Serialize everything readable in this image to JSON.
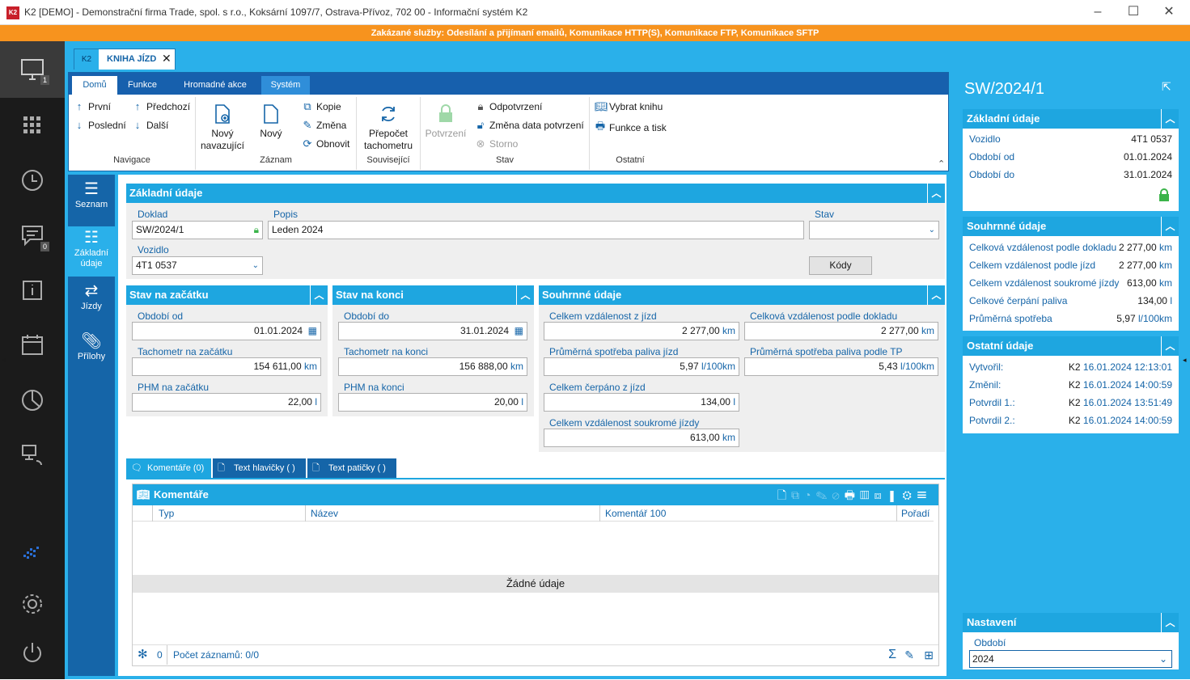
{
  "window": {
    "title": "K2 [DEMO] - Demonstrační firma Trade, spol. s r.o., Koksární 1097/7, Ostrava-Přívoz, 702 00 - Informační systém K2",
    "logo": "K2"
  },
  "warning": "Zakázané služby: Odesílání a přijímaní emailů, Komunikace HTTP(S), Komunikace FTP, Komunikace SFTP",
  "leftnav": {
    "monitor_badge": "1",
    "messages_badge": "0",
    "icons": [
      "monitor-icon",
      "apps-grid-icon",
      "history-icon",
      "messages-icon",
      "info-icon",
      "calendar-icon",
      "pie-chart-icon",
      "remote-support-icon",
      "k2-logo-icon",
      "settings-icon",
      "power-icon"
    ]
  },
  "doc_tab": {
    "prefix": "K2",
    "label": "KNIHA JÍZD",
    "close": "✕"
  },
  "ribbon": {
    "tabs": [
      "Domů",
      "Funkce",
      "Hromadné akce",
      "Systém"
    ],
    "navigation": {
      "first": "První",
      "last": "Poslední",
      "prev": "Předchozí",
      "next": "Další",
      "group": "Navigace"
    },
    "record": {
      "new_follow_1": "Nový",
      "new_follow_2": "navazující",
      "new": "Nový",
      "copy": "Kopie",
      "change": "Změna",
      "refresh": "Obnovit",
      "group": "Záznam"
    },
    "related": {
      "recalc_1": "Přepočet",
      "recalc_2": "tachometru",
      "group": "Související"
    },
    "state": {
      "confirm": "Potvrzení",
      "unconfirm": "Odpotvrzení",
      "change_date": "Změna data potvrzení",
      "storno": "Storno",
      "group": "Stav"
    },
    "other": {
      "select_book": "Vybrat knihu",
      "functions_print": "Funkce a tisk",
      "group": "Ostatní"
    }
  },
  "sidetabs": [
    {
      "label": "Seznam",
      "label2": ""
    },
    {
      "label": "Základní",
      "label2": "údaje"
    },
    {
      "label": "Jízdy",
      "label2": ""
    },
    {
      "label": "Přílohy",
      "label2": ""
    }
  ],
  "basic": {
    "title": "Základní údaje",
    "doklad_label": "Doklad",
    "doklad_value": "SW/2024/1",
    "popis_label": "Popis",
    "popis_value": "Leden 2024",
    "stav_label": "Stav",
    "stav_value": "",
    "vozidlo_label": "Vozidlo",
    "vozidlo_value": "4T1 0537",
    "kody_button": "Kódy"
  },
  "start": {
    "title": "Stav na začátku",
    "period_label": "Období od",
    "period_value": "01.01.2024",
    "tacho_label": "Tachometr na začátku",
    "tacho_value": "154 611,00",
    "tacho_unit": "km",
    "fuel_label": "PHM na začátku",
    "fuel_value": "22,00",
    "fuel_unit": "l"
  },
  "end": {
    "title": "Stav na konci",
    "period_label": "Období do",
    "period_value": "31.01.2024",
    "tacho_label": "Tachometr na konci",
    "tacho_value": "156 888,00",
    "tacho_unit": "km",
    "fuel_label": "PHM na konci",
    "fuel_value": "20,00",
    "fuel_unit": "l"
  },
  "summary": {
    "title": "Souhrnné údaje",
    "total_dist_label": "Celkem vzdálenost z jízd",
    "total_dist_value": "2 277,00",
    "total_dist_unit": "km",
    "doc_dist_label": "Celková vzdálenost podle dokladu",
    "doc_dist_value": "2 277,00",
    "doc_dist_unit": "km",
    "avg_label": "Průměrná spotřeba paliva jízd",
    "avg_value": "5,97",
    "avg_unit": "l/100km",
    "avg_tp_label": "Průměrná spotřeba paliva podle TP",
    "avg_tp_value": "5,43",
    "avg_tp_unit": "l/100km",
    "pumped_label": "Celkem čerpáno z jízd",
    "pumped_value": "134,00",
    "pumped_unit": "l",
    "private_label": "Celkem vzdálenost soukromé jízdy",
    "private_value": "613,00",
    "private_unit": "km"
  },
  "bottom_tabs": [
    "Komentáře (0)",
    "Text hlavičky ( )",
    "Text patičky ( )"
  ],
  "comments": {
    "title": "Komentáře",
    "columns": [
      "Typ",
      "Název",
      "Komentář 100",
      "Pořadí"
    ],
    "empty": "Žádné údaje",
    "count_zero": "0",
    "record_count": "Počet záznamů: 0/0"
  },
  "right": {
    "doc_id": "SW/2024/1",
    "basic": {
      "title": "Základní údaje",
      "rows": [
        {
          "k": "Vozidlo",
          "v": "4T1 0537"
        },
        {
          "k": "Období od",
          "v": "01.01.2024"
        },
        {
          "k": "Období do",
          "v": "31.01.2024"
        }
      ]
    },
    "summary": {
      "title": "Souhrnné údaje",
      "rows": [
        {
          "k": "Celková vzdálenost podle dokladu",
          "v": "2 277,00",
          "u": "km"
        },
        {
          "k": "Celkem vzdálenost podle jízd",
          "v": "2 277,00",
          "u": "km"
        },
        {
          "k": "Celkem vzdálenost soukromé jízdy",
          "v": "613,00",
          "u": "km"
        },
        {
          "k": "Celkové čerpání paliva",
          "v": "134,00",
          "u": "l"
        },
        {
          "k": "Průměrná spotřeba",
          "v": "5,97",
          "u": "l/100km"
        }
      ]
    },
    "other": {
      "title": "Ostatní údaje",
      "rows": [
        {
          "k": "Vytvořil:",
          "user": "K2",
          "d": "16.01.2024 12:13:01"
        },
        {
          "k": "Změnil:",
          "user": "K2",
          "d": "16.01.2024 14:00:59"
        },
        {
          "k": "Potvrdil 1.:",
          "user": "K2",
          "d": "16.01.2024 13:51:49"
        },
        {
          "k": "Potvrdil 2.:",
          "user": "K2",
          "d": "16.01.2024 14:00:59"
        }
      ]
    },
    "settings": {
      "title": "Nastavení",
      "period_label": "Období",
      "period_value": "2024"
    }
  }
}
